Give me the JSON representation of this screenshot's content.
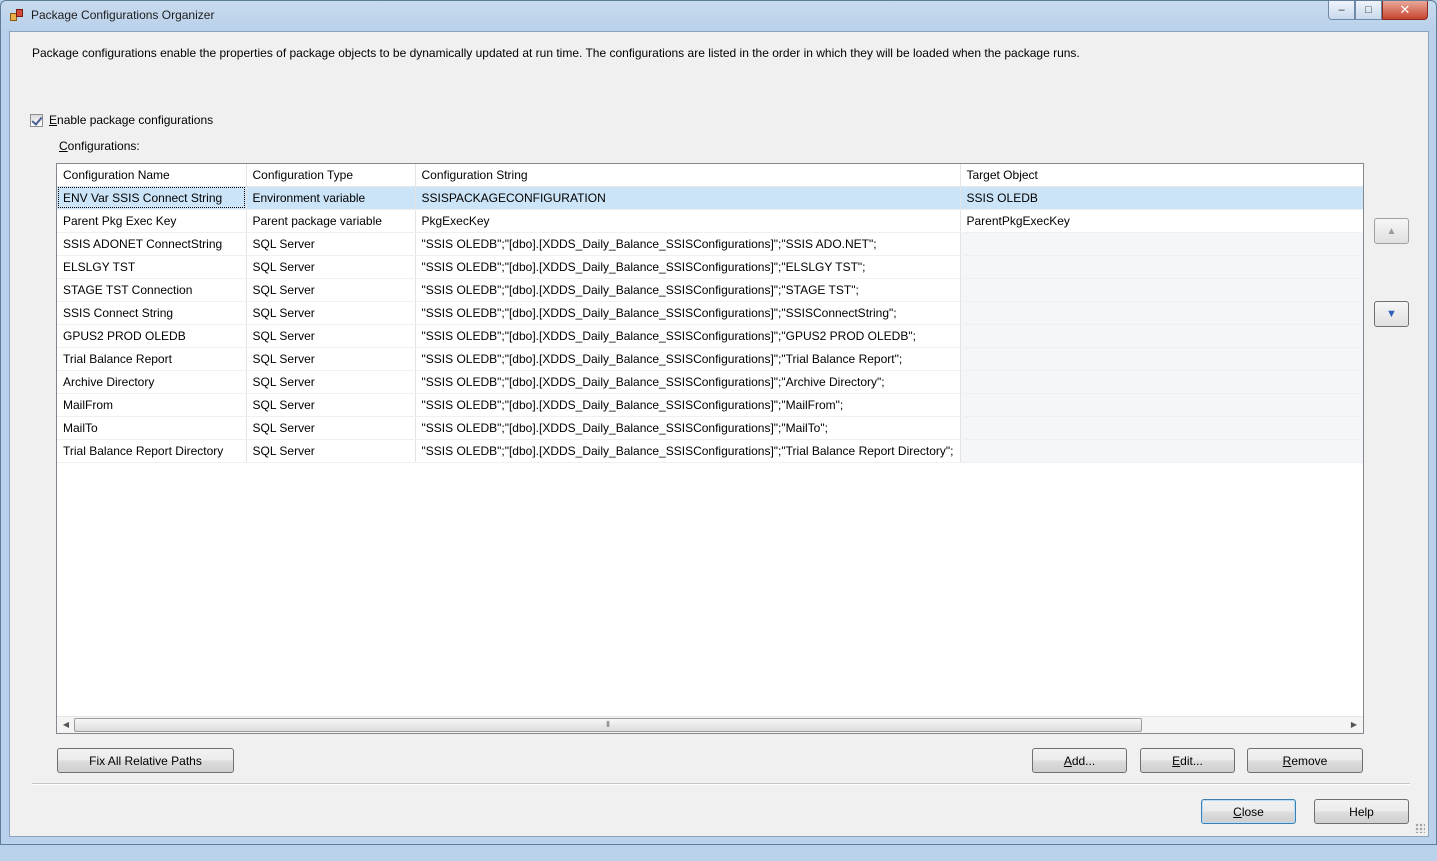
{
  "window": {
    "title": "Package Configurations Organizer",
    "caption": {
      "minimize": "–",
      "maximize": "□",
      "close": "✕"
    }
  },
  "description": "Package configurations enable the properties of package objects to be dynamically updated at run time. The configurations are listed in the order in which they will be loaded when the package runs.",
  "enable": {
    "mnemonic": "E",
    "rest": "nable package configurations",
    "checked": true
  },
  "configurations_label": {
    "mnemonic": "C",
    "rest": "onfigurations:"
  },
  "grid": {
    "columns": [
      "Configuration Name",
      "Configuration Type",
      "Configuration String",
      "Target Object"
    ],
    "rows": [
      {
        "name": "ENV Var SSIS Connect String",
        "type": "Environment variable",
        "string": "SSISPACKAGECONFIGURATION",
        "target": "SSIS OLEDB"
      },
      {
        "name": "Parent Pkg Exec Key",
        "type": "Parent package variable",
        "string": "PkgExecKey",
        "target": "ParentPkgExecKey"
      },
      {
        "name": "SSIS ADONET ConnectString",
        "type": "SQL Server",
        "string": "\"SSIS OLEDB\";\"[dbo].[XDDS_Daily_Balance_SSISConfigurations]\";\"SSIS  ADO.NET\";",
        "target": ""
      },
      {
        "name": "ELSLGY TST",
        "type": "SQL Server",
        "string": "\"SSIS OLEDB\";\"[dbo].[XDDS_Daily_Balance_SSISConfigurations]\";\"ELSLGY TST\";",
        "target": ""
      },
      {
        "name": "STAGE TST Connection",
        "type": "SQL Server",
        "string": "\"SSIS OLEDB\";\"[dbo].[XDDS_Daily_Balance_SSISConfigurations]\";\"STAGE TST\";",
        "target": ""
      },
      {
        "name": "SSIS Connect String",
        "type": "SQL Server",
        "string": "\"SSIS OLEDB\";\"[dbo].[XDDS_Daily_Balance_SSISConfigurations]\";\"SSISConnectString\";",
        "target": ""
      },
      {
        "name": "GPUS2 PROD OLEDB",
        "type": "SQL Server",
        "string": "\"SSIS OLEDB\";\"[dbo].[XDDS_Daily_Balance_SSISConfigurations]\";\"GPUS2 PROD OLEDB\";",
        "target": ""
      },
      {
        "name": "Trial Balance Report",
        "type": "SQL Server",
        "string": "\"SSIS OLEDB\";\"[dbo].[XDDS_Daily_Balance_SSISConfigurations]\";\"Trial Balance Report\";",
        "target": ""
      },
      {
        "name": "Archive Directory",
        "type": "SQL Server",
        "string": "\"SSIS OLEDB\";\"[dbo].[XDDS_Daily_Balance_SSISConfigurations]\";\"Archive Directory\";",
        "target": ""
      },
      {
        "name": "MailFrom",
        "type": "SQL Server",
        "string": "\"SSIS OLEDB\";\"[dbo].[XDDS_Daily_Balance_SSISConfigurations]\";\"MailFrom\";",
        "target": ""
      },
      {
        "name": "MailTo",
        "type": "SQL Server",
        "string": "\"SSIS OLEDB\";\"[dbo].[XDDS_Daily_Balance_SSISConfigurations]\";\"MailTo\";",
        "target": ""
      },
      {
        "name": "Trial Balance Report Directory",
        "type": "SQL Server",
        "string": "\"SSIS OLEDB\";\"[dbo].[XDDS_Daily_Balance_SSISConfigurations]\";\"Trial Balance Report Directory\";",
        "target": ""
      }
    ],
    "selected_index": 0
  },
  "icons": {
    "move_up": "arrow-up-icon",
    "move_down": "arrow-down-icon"
  },
  "buttons": {
    "fix_paths": "Fix All Relative Paths",
    "add": {
      "mnemonic": "A",
      "rest": "dd..."
    },
    "edit": {
      "mnemonic": "E",
      "rest": "dit..."
    },
    "remove": {
      "mnemonic": "R",
      "rest": "emove"
    },
    "close": {
      "mnemonic": "C",
      "rest": "lose"
    },
    "help": "Help"
  }
}
